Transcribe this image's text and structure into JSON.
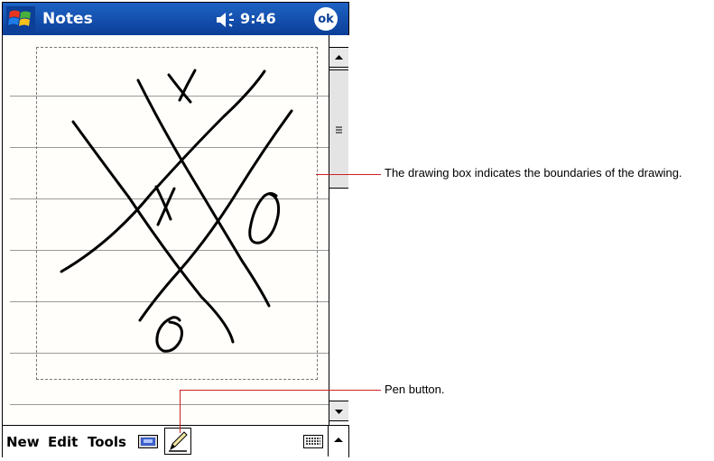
{
  "titlebar": {
    "app_title": "Notes",
    "clock": "9:46",
    "ok_label": "ok"
  },
  "menubar": {
    "new_label": "New",
    "edit_label": "Edit",
    "tools_label": "Tools"
  },
  "callouts": {
    "drawing_box": "The drawing box indicates the boundaries of the drawing.",
    "pen_button": "Pen button."
  },
  "colors": {
    "titlebar": "#0b3f98",
    "callout_line": "#cc2020"
  },
  "icons": [
    "windows-start-icon",
    "speaker-icon",
    "recording-icon",
    "pen-icon",
    "keyboard-icon",
    "up-arrow-icon",
    "down-arrow-icon",
    "scroll-grip-icon"
  ]
}
